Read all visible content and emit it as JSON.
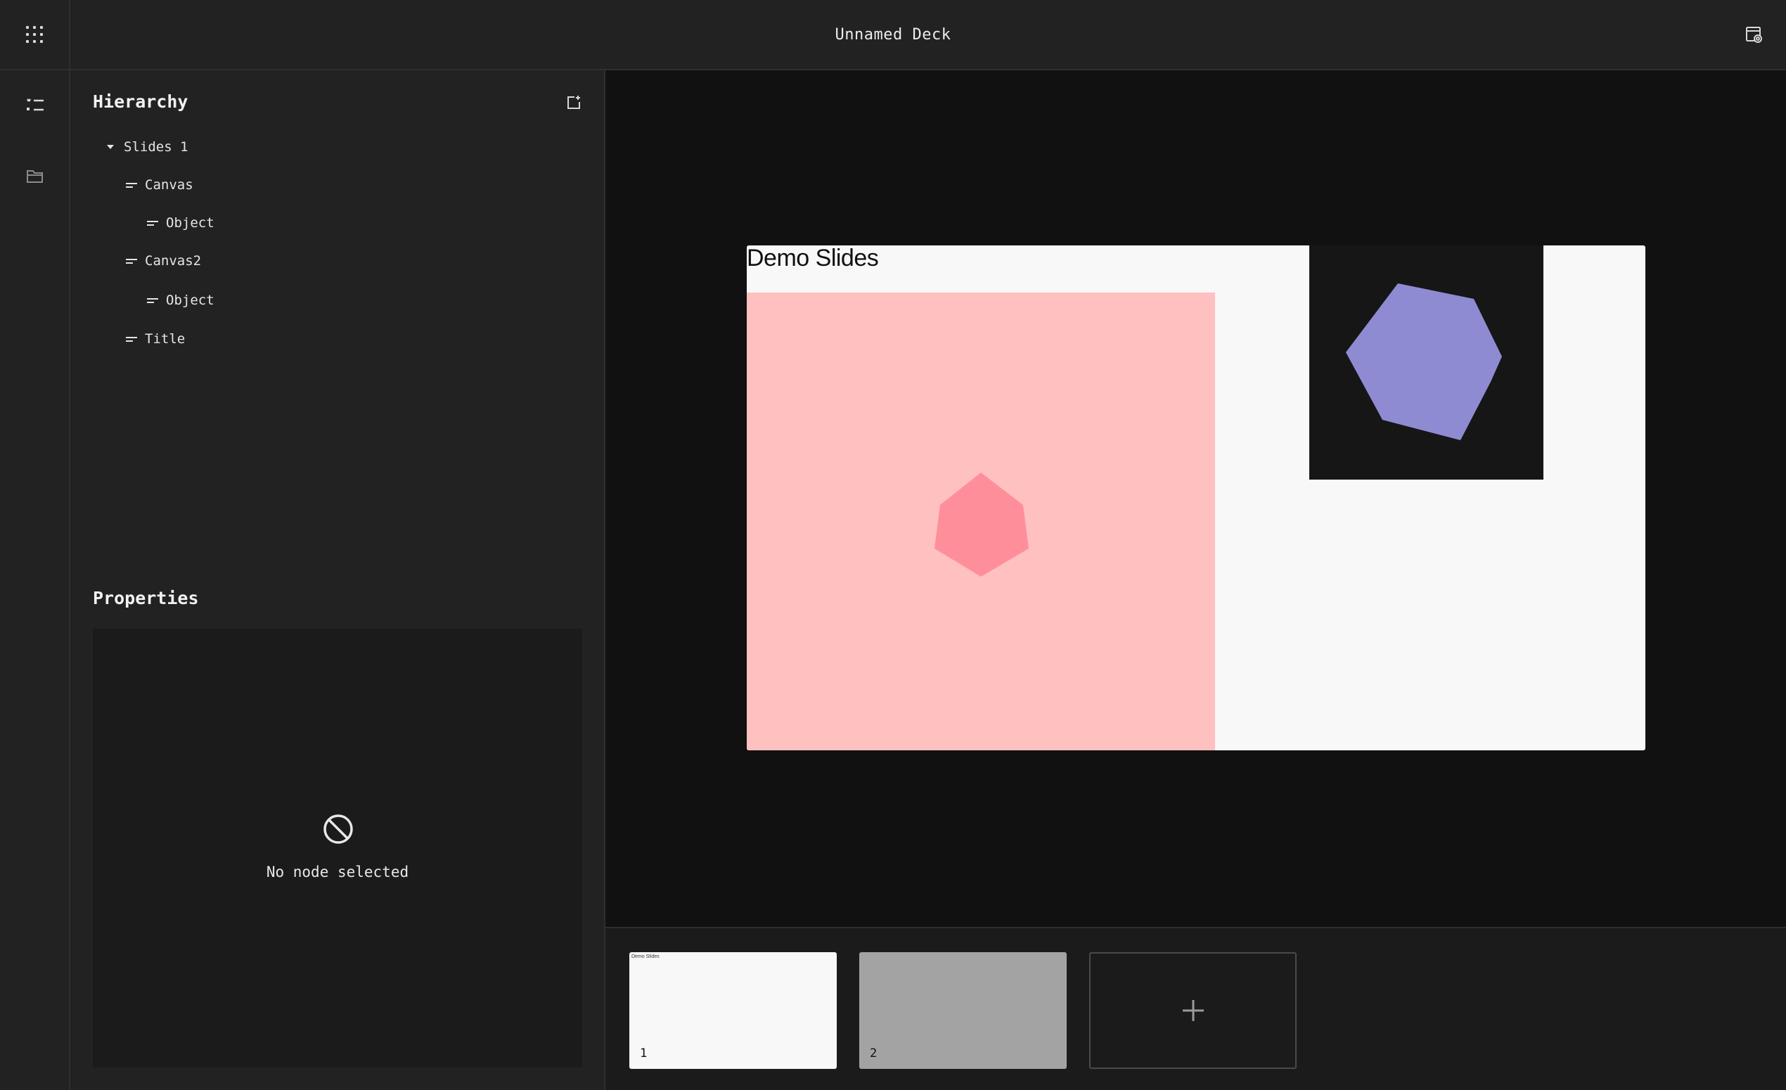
{
  "header": {
    "title": "Unnamed Deck",
    "apps_icon": "grid-dots-icon",
    "present_icon": "present-window-icon"
  },
  "rail": {
    "items": [
      {
        "name": "hierarchy",
        "icon": "list-tree-icon"
      },
      {
        "name": "assets",
        "icon": "folder-icon"
      }
    ]
  },
  "hierarchy": {
    "title": "Hierarchy",
    "add_icon": "add-node-icon",
    "nodes": [
      {
        "label": "Slides 1",
        "icon": "caret-down-icon"
      },
      {
        "label": "Canvas",
        "icon": "node-lines-icon"
      },
      {
        "label": "Object",
        "icon": "node-lines-icon"
      },
      {
        "label": "Canvas2",
        "icon": "node-lines-icon"
      },
      {
        "label": "Object",
        "icon": "node-lines-icon"
      },
      {
        "label": "Title",
        "icon": "node-lines-icon"
      }
    ]
  },
  "properties": {
    "title": "Properties",
    "empty_icon": "no-entry-icon",
    "empty_text": "No node selected"
  },
  "slide": {
    "title": "Demo Slides",
    "background": "#f8f8f8",
    "canvas_color": "#ffc0c0",
    "canvas2_color": "#161616",
    "pink_shape_color": "#ff8e9b",
    "purple_shape_color": "#8f8bd2"
  },
  "thumbnails": [
    {
      "number": "1",
      "mini_title": "Demo Slides",
      "color": "#f8f8f8"
    },
    {
      "number": "2",
      "color": "#a3a3a3"
    }
  ],
  "add_slide": {
    "icon": "plus-icon",
    "glyph": "+"
  }
}
